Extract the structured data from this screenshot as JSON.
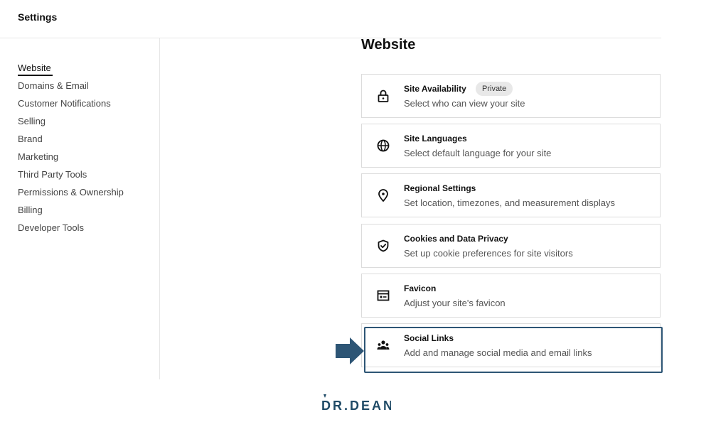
{
  "header": {
    "title": "Settings"
  },
  "sidebar": {
    "active_index": 0,
    "items": [
      {
        "label": "Website"
      },
      {
        "label": "Domains & Email"
      },
      {
        "label": "Customer Notifications"
      },
      {
        "label": "Selling"
      },
      {
        "label": "Brand"
      },
      {
        "label": "Marketing"
      },
      {
        "label": "Third Party Tools"
      },
      {
        "label": "Permissions & Ownership"
      },
      {
        "label": "Billing"
      },
      {
        "label": "Developer Tools"
      }
    ]
  },
  "main": {
    "title": "Website",
    "cards": [
      {
        "icon": "lock-icon",
        "title": "Site Availability",
        "badge": "Private",
        "description": "Select who can view your site"
      },
      {
        "icon": "globe-icon",
        "title": "Site Languages",
        "description": "Select default language for your site"
      },
      {
        "icon": "location-pin-icon",
        "title": "Regional Settings",
        "description": "Set location, timezones, and measurement displays"
      },
      {
        "icon": "shield-check-icon",
        "title": "Cookies and Data Privacy",
        "description": "Set up cookie preferences for site visitors"
      },
      {
        "icon": "browser-window-icon",
        "title": "Favicon",
        "description": "Adjust your site's favicon"
      },
      {
        "icon": "people-icon",
        "title": "Social Links",
        "description": "Add and manage social media and email links"
      }
    ]
  },
  "annotation": {
    "highlight_color": "#2d5575",
    "arrow_color": "#2d5575"
  },
  "branding": {
    "logo_text": "DR.DEAN",
    "color": "#1f4a66"
  }
}
